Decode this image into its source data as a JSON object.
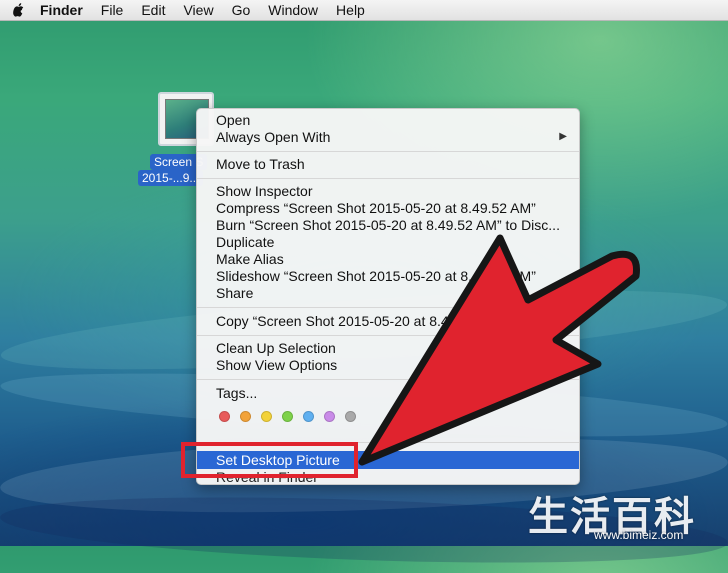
{
  "menubar": {
    "apple_icon": "apple-logo-icon",
    "items": [
      "Finder",
      "File",
      "Edit",
      "View",
      "Go",
      "Window",
      "Help"
    ]
  },
  "desktop_icon": {
    "label_line1": "Screen S",
    "label_line2": "2015-...9..."
  },
  "context_menu": {
    "open": "Open",
    "always_open_with": "Always Open With",
    "submenu_arrow": "▶",
    "move_to_trash": "Move to Trash",
    "show_inspector": "Show Inspector",
    "compress": "Compress “Screen Shot 2015-05-20 at 8.49.52 AM”",
    "burn": "Burn “Screen Shot 2015-05-20 at 8.49.52 AM” to Disc...",
    "duplicate": "Duplicate",
    "make_alias": "Make Alias",
    "slideshow": "Slideshow “Screen Shot 2015-05-20 at 8.49.52 AM”",
    "share": "Share",
    "copy": "Copy “Screen Shot 2015-05-20 at 8.49.52 AM”",
    "clean_up_selection": "Clean Up Selection",
    "show_view_options": "Show View Options",
    "tags": "Tags...",
    "tag_colors": [
      "#e85b5b",
      "#f2a33a",
      "#f2d23a",
      "#7ed24a",
      "#5fb0f0",
      "#c98be8",
      "#a9a9a9"
    ],
    "set_desktop_picture": "Set Desktop Picture",
    "reveal_in_finder": "Reveal in Finder"
  },
  "annotation": {
    "arrow_color": "#e0232e",
    "box_color": "#e0232e"
  },
  "watermark": {
    "chars": "生活百科",
    "url": "www.bimeiz.com"
  }
}
